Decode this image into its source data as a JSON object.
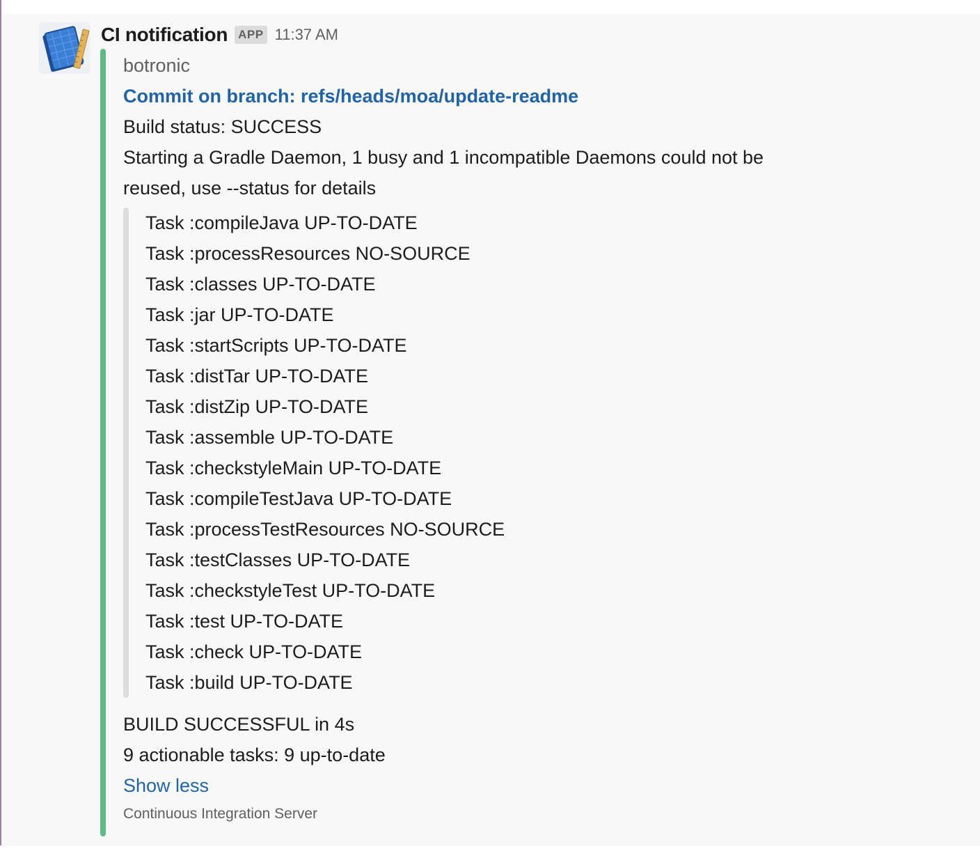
{
  "message": {
    "sender": "CI notification",
    "app_badge": "APP",
    "timestamp": "11:37 AM",
    "avatar_icon": "blueprint-book-icon"
  },
  "attachment": {
    "accent_color": "#5eba86",
    "author": "botronic",
    "title": "Commit on branch: refs/heads/moa/update-readme",
    "text_lines": [
      "Build status: SUCCESS",
      "Starting a Gradle Daemon, 1 busy and 1 incompatible Daemons could not be",
      "reused, use --status for details"
    ],
    "quote_lines": [
      "Task :compileJava UP-TO-DATE",
      "Task :processResources NO-SOURCE",
      "Task :classes UP-TO-DATE",
      "Task :jar UP-TO-DATE",
      "Task :startScripts UP-TO-DATE",
      "Task :distTar UP-TO-DATE",
      "Task :distZip UP-TO-DATE",
      "Task :assemble UP-TO-DATE",
      "Task :checkstyleMain UP-TO-DATE",
      "Task :compileTestJava UP-TO-DATE",
      "Task :processTestResources NO-SOURCE",
      "Task :testClasses UP-TO-DATE",
      "Task :checkstyleTest UP-TO-DATE",
      "Task :test UP-TO-DATE",
      "Task :check UP-TO-DATE",
      "Task :build UP-TO-DATE"
    ],
    "summary_lines": [
      "BUILD SUCCESSFUL in 4s",
      "9 actionable tasks: 9 up-to-date"
    ],
    "show_less": "Show less",
    "footer": "Continuous Integration Server"
  }
}
